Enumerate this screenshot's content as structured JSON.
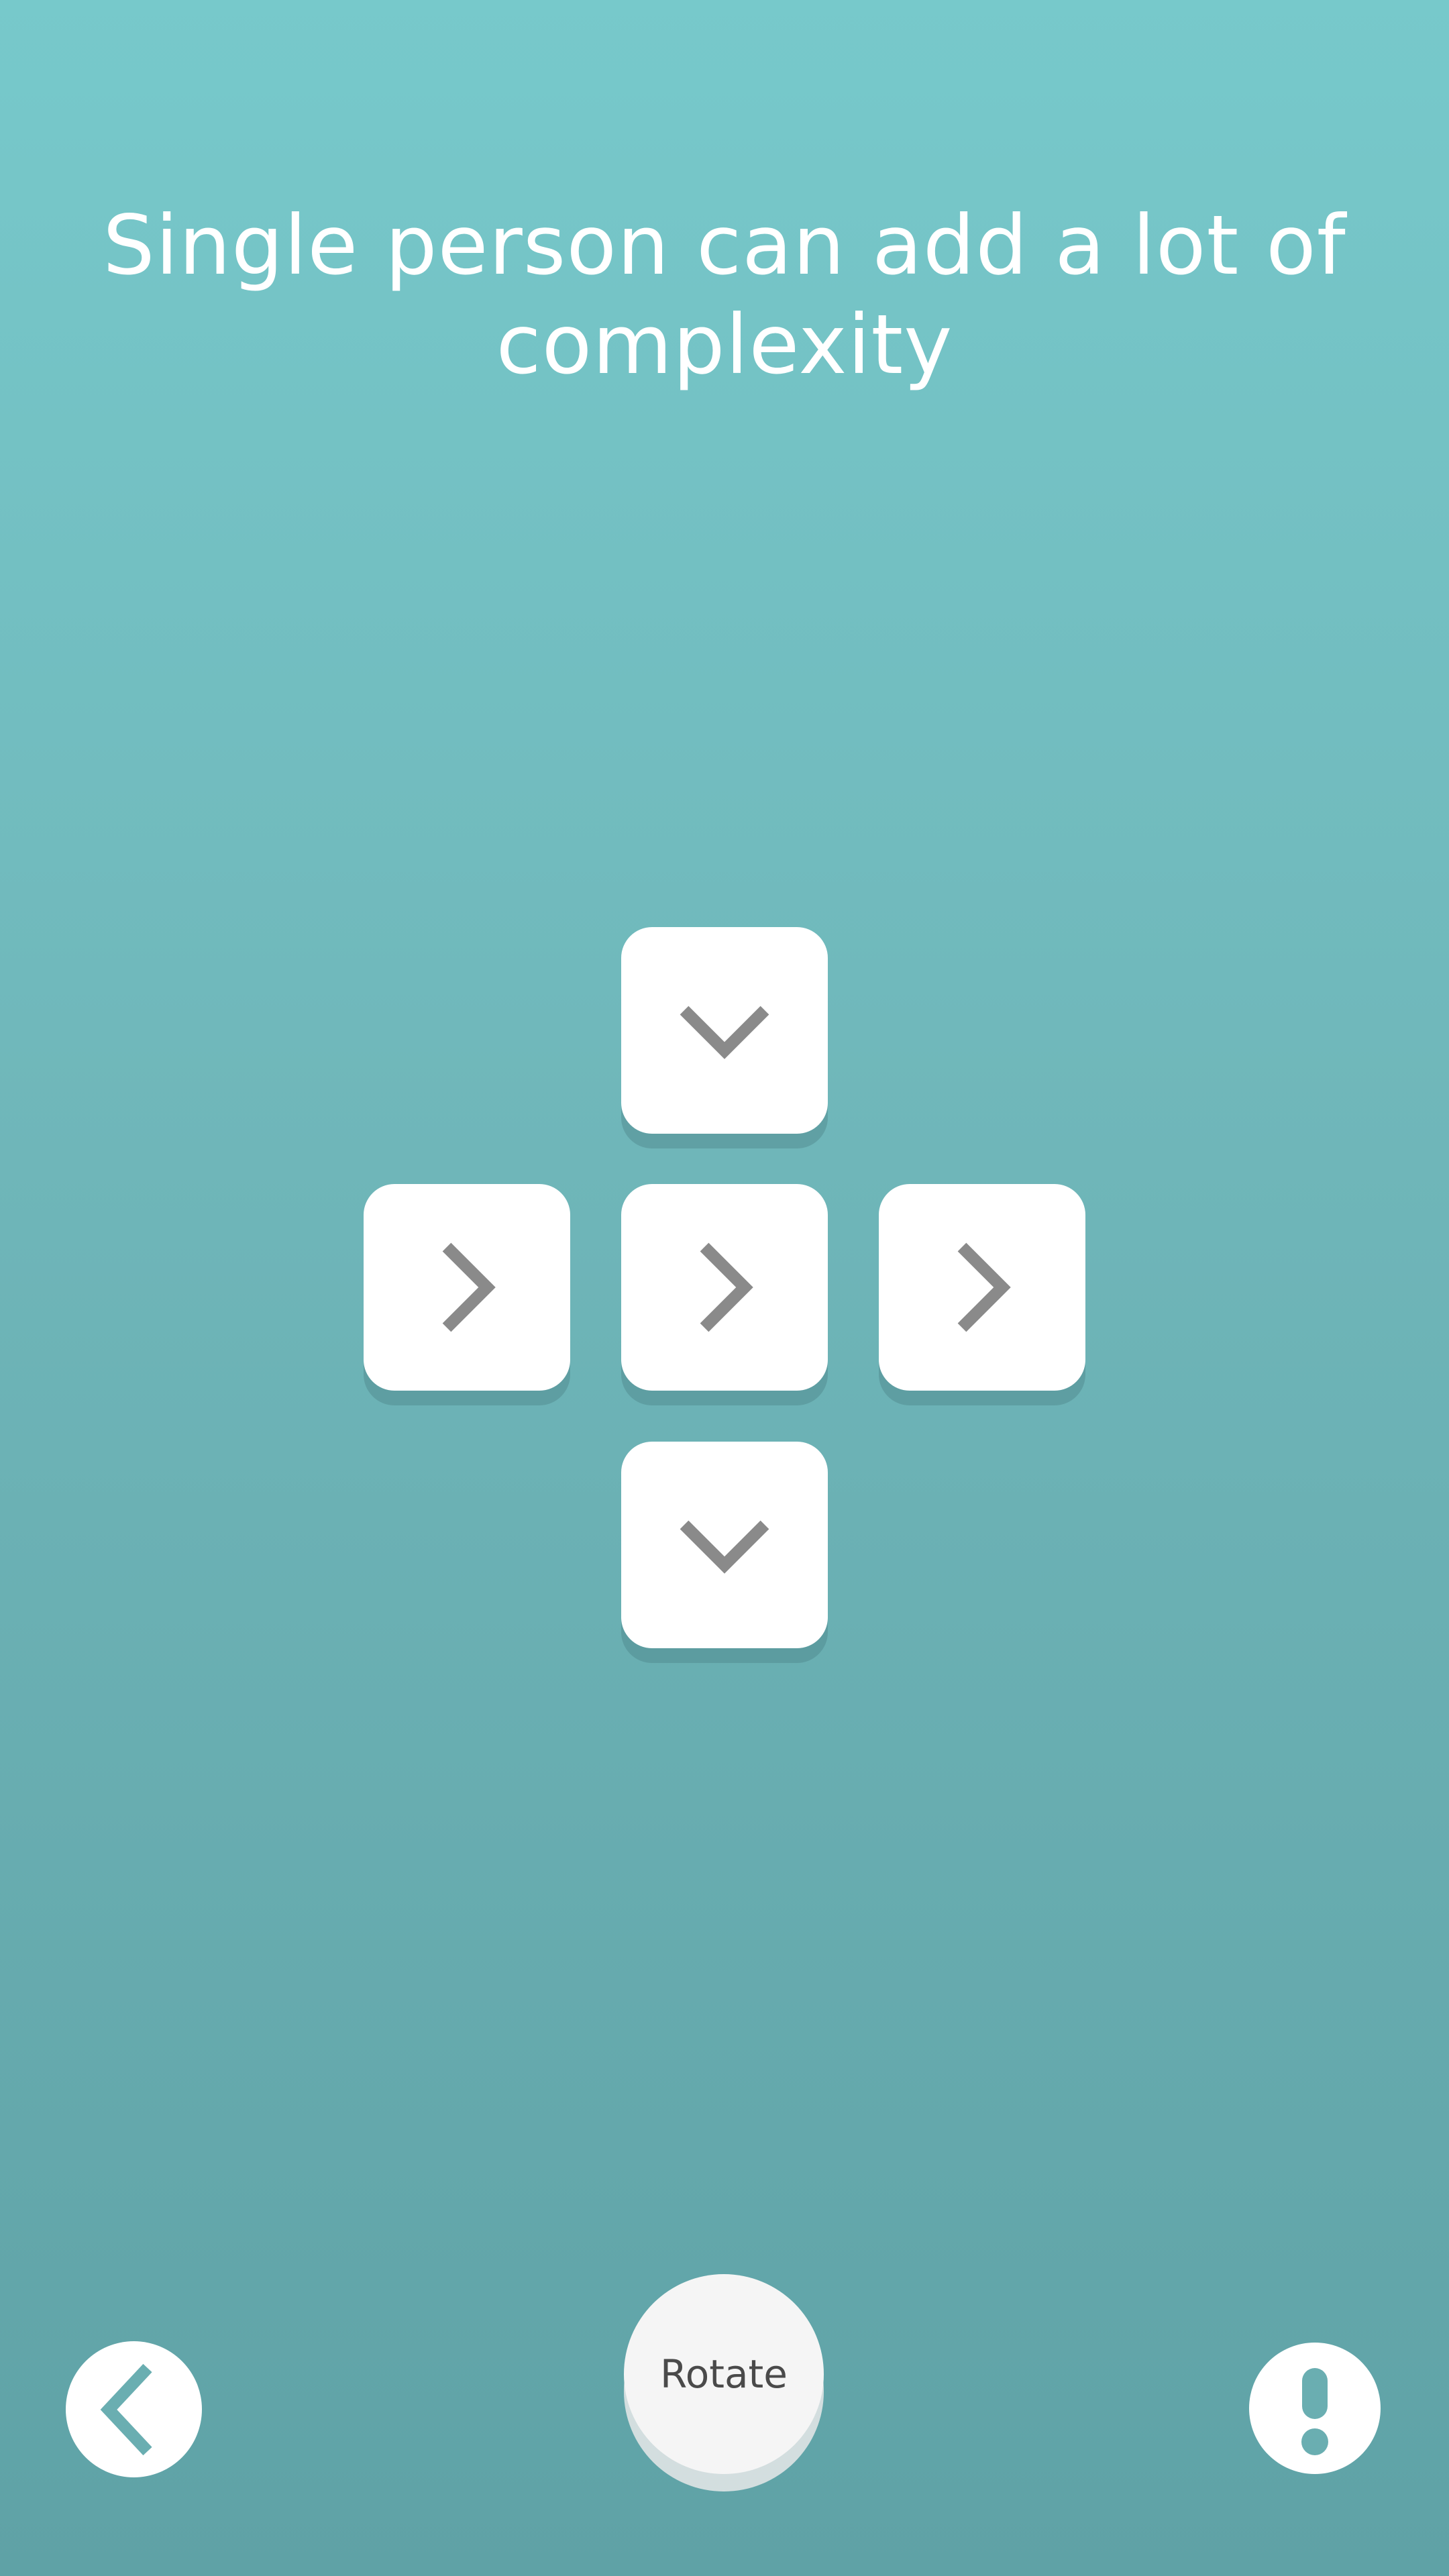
{
  "title": "Single person can add a lot of complexity",
  "board": {
    "tiles": [
      {
        "id": "top",
        "direction": "down",
        "icon": "chevron-down-icon"
      },
      {
        "id": "left",
        "direction": "right",
        "icon": "chevron-right-icon"
      },
      {
        "id": "center",
        "direction": "right",
        "icon": "chevron-right-icon"
      },
      {
        "id": "right",
        "direction": "right",
        "icon": "chevron-right-icon"
      },
      {
        "id": "bottom",
        "direction": "down",
        "icon": "chevron-down-icon"
      }
    ]
  },
  "controls": {
    "rotate_label": "Rotate",
    "back_icon": "chevron-left-icon",
    "info_icon": "exclamation-icon"
  },
  "colors": {
    "background_top": "#77c9cb",
    "background_bottom": "#5fa2a6",
    "tile": "#ffffff",
    "arrow": "#8a8a8a",
    "accent": "#6aaeb1"
  }
}
